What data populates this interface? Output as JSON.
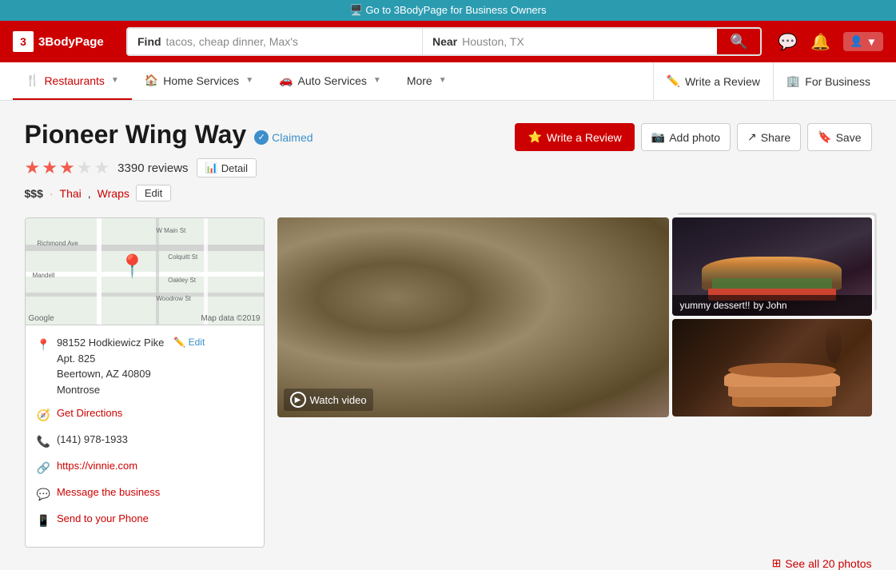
{
  "topBanner": {
    "text": "Go to 3BodyPage for Business Owners"
  },
  "header": {
    "logo": {
      "number": "3",
      "name": "3BodyPage"
    },
    "search": {
      "findLabel": "Find",
      "findPlaceholder": "tacos, cheap dinner, Max's",
      "nearLabel": "Near",
      "nearPlaceholder": "Houston, TX"
    },
    "icons": {
      "search": "🔍",
      "messages": "💬",
      "notifications": "🔔",
      "avatar": "👤"
    }
  },
  "nav": {
    "items": [
      {
        "id": "restaurants",
        "label": "Restaurants",
        "icon": "🍴",
        "active": true
      },
      {
        "id": "home-services",
        "label": "Home Services",
        "icon": "🏠"
      },
      {
        "id": "auto-services",
        "label": "Auto Services",
        "icon": "🚗"
      },
      {
        "id": "more",
        "label": "More",
        "icon": ""
      }
    ],
    "rightItems": [
      {
        "id": "write-review",
        "label": "Write a Review",
        "icon": "✏️"
      },
      {
        "id": "for-business",
        "label": "For Business",
        "icon": "🏢"
      }
    ]
  },
  "business": {
    "name": "Pioneer Wing Way",
    "claimed": true,
    "claimedLabel": "Claimed",
    "rating": {
      "value": 2.5,
      "count": "3390",
      "countLabel": "3390 reviews"
    },
    "price": "$$$",
    "categories": [
      "Thai",
      "Wraps"
    ],
    "address": {
      "street": "98152 Hodkiewicz Pike",
      "apt": "Apt. 825",
      "city": "Beertown, AZ 40809",
      "neighborhood": "Montrose"
    },
    "phone": "(141) 978-1933",
    "website": "https://vinnie.com",
    "actions": {
      "writeReview": "Write a Review",
      "addPhoto": "Add photo",
      "share": "Share",
      "save": "Save",
      "detail": "Detail",
      "edit": "Edit",
      "getDirections": "Get Directions",
      "messageLabel": "Message the business",
      "sendToPhone": "Send to your Phone",
      "editAddress": "Edit"
    }
  },
  "photos": {
    "watchVideo": "Watch video",
    "captionText": "yummy dessert!!",
    "captionBy": "by John",
    "seeAllCount": "20",
    "seeAllLabel": "See all 20 photos"
  },
  "mapAttribution": "Google",
  "mapData": "Map data ©2019"
}
